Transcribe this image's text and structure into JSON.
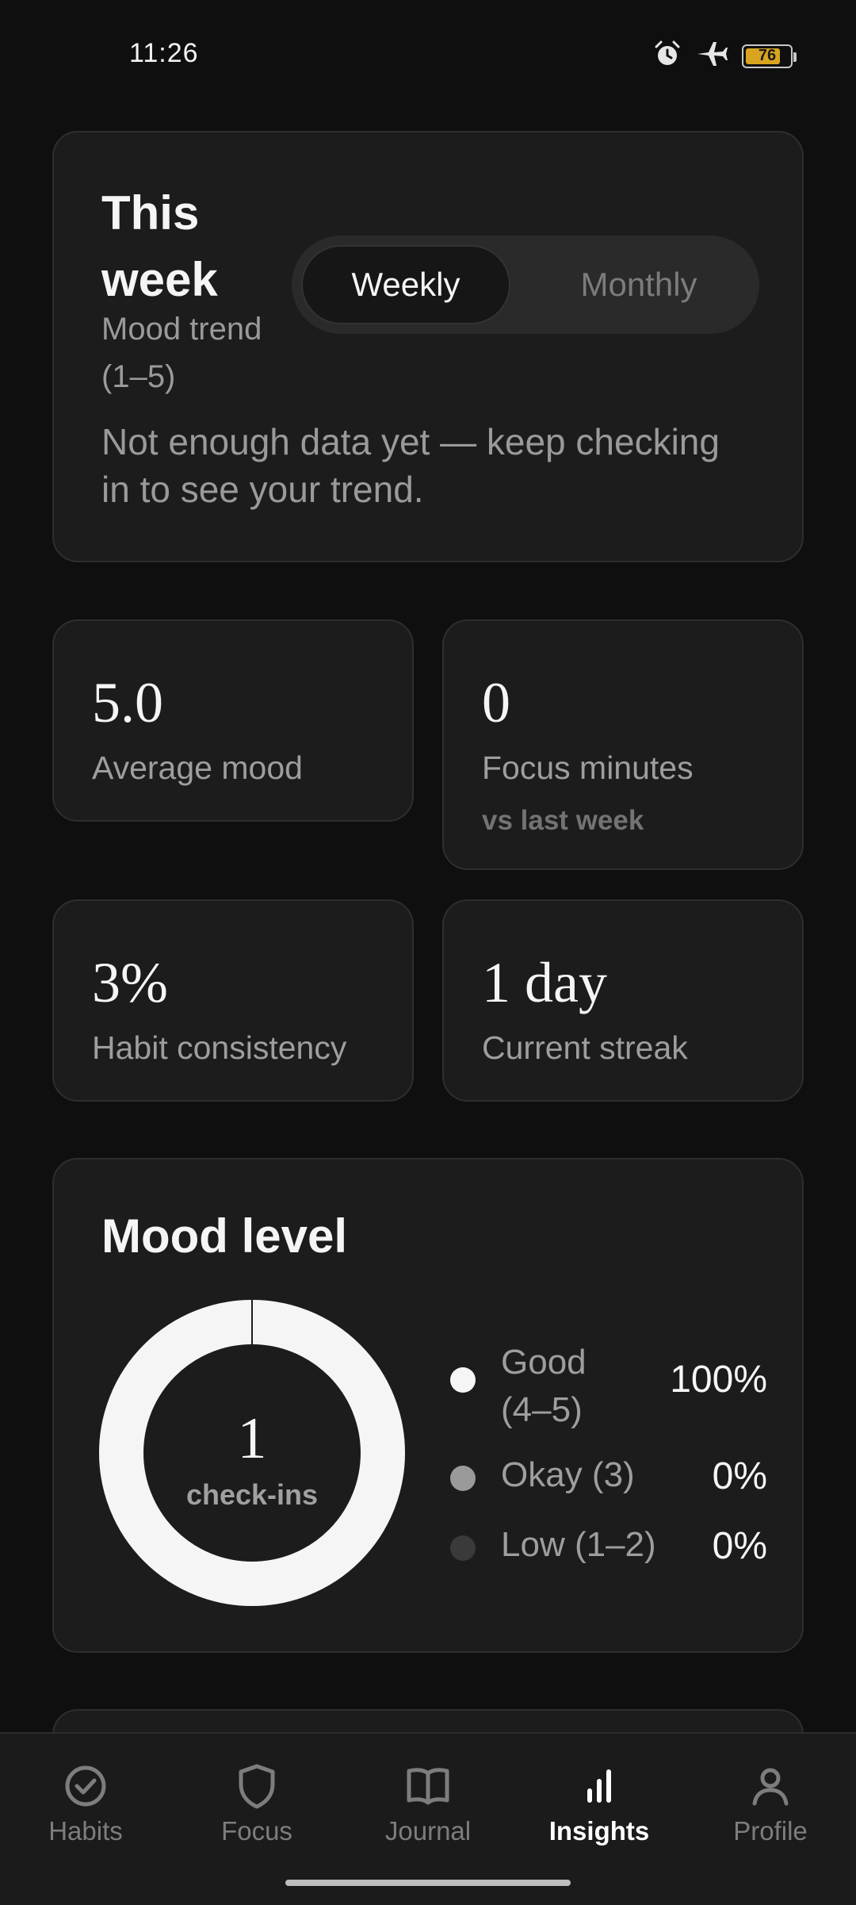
{
  "status_bar": {
    "time": "11:26",
    "battery_level": "76",
    "icons": [
      "alarm-icon",
      "airplane-icon",
      "battery-icon"
    ]
  },
  "week_card": {
    "title": "This week",
    "subtitle": "Mood trend (1–5)",
    "toggle": {
      "weekly": "Weekly",
      "monthly": "Monthly",
      "selected": "Weekly"
    },
    "message": "Not enough data yet — keep checking in to see your trend."
  },
  "stats": [
    {
      "value": "5.0",
      "label": "Average mood"
    },
    {
      "value": "0",
      "label": "Focus minutes",
      "sub": "vs last week"
    },
    {
      "value": "3%",
      "label": "Habit consistency"
    },
    {
      "value": "1 day",
      "label": "Current streak"
    }
  ],
  "mood_level": {
    "title": "Mood level",
    "count": "1",
    "count_label": "check-ins",
    "legend": [
      {
        "label": "Good (4–5)",
        "percent": "100%",
        "fraction": 1.0,
        "color": "#f5f5f5"
      },
      {
        "label": "Okay (3)",
        "percent": "0%",
        "fraction": 0.0,
        "color": "#9a9a9a"
      },
      {
        "label": "Low (1–2)",
        "percent": "0%",
        "fraction": 0.0,
        "color": "#3a3a3a"
      }
    ]
  },
  "nav": {
    "active": "Insights",
    "items": [
      {
        "label": "Habits",
        "icon": "check-circle-icon"
      },
      {
        "label": "Focus",
        "icon": "shield-icon"
      },
      {
        "label": "Journal",
        "icon": "book-icon"
      },
      {
        "label": "Insights",
        "icon": "bar-chart-icon"
      },
      {
        "label": "Profile",
        "icon": "person-icon"
      }
    ]
  },
  "colors": {
    "background": "#0f0f0f",
    "card": "#1c1c1c",
    "accent": "#f5f5f5",
    "battery": "#d9a520"
  }
}
